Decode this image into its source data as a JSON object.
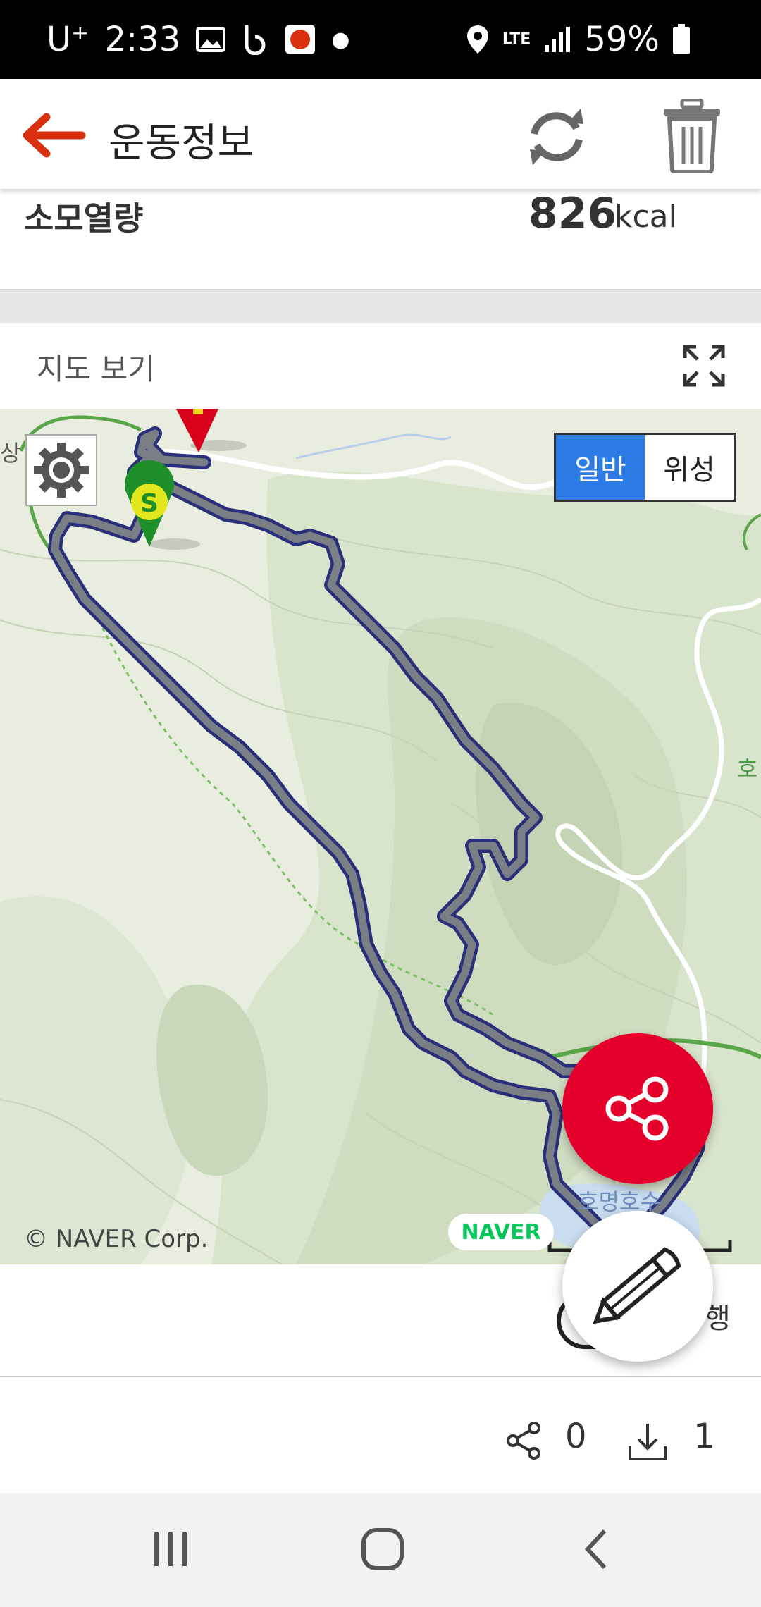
{
  "status_bar": {
    "carrier": "U⁺",
    "time": "2:33",
    "network": "LTE",
    "battery": "59%"
  },
  "app_bar": {
    "title": "운동정보",
    "icons": [
      "back-arrow-icon",
      "refresh-icon",
      "trash-icon"
    ],
    "accent_color": "#d9310f"
  },
  "calories": {
    "label": "소모열량",
    "value": "826",
    "unit": "kcal"
  },
  "map_section": {
    "label": "지도 보기",
    "expand_icon": "expand-icon",
    "map_type_options": [
      "일반",
      "위성"
    ],
    "selected_map_type": "일반",
    "copyright": "© NAVER Corp.",
    "logo": "NAVER",
    "place_labels": {
      "lake": "호명호수",
      "left_edge": "상",
      "right_edge": "호"
    },
    "start_marker_letter": "S",
    "route_color": "#2a2f7a"
  },
  "below_map": {
    "clipped_label": "행"
  },
  "stats": {
    "share_count": "0",
    "download_count": "1"
  },
  "fabs": {
    "share_color": "#e4002b",
    "share_icon": "share-icon",
    "edit_icon": "pencil-icon"
  },
  "nav_bar": {
    "icons": [
      "recent-apps-icon",
      "home-icon",
      "back-icon"
    ]
  }
}
